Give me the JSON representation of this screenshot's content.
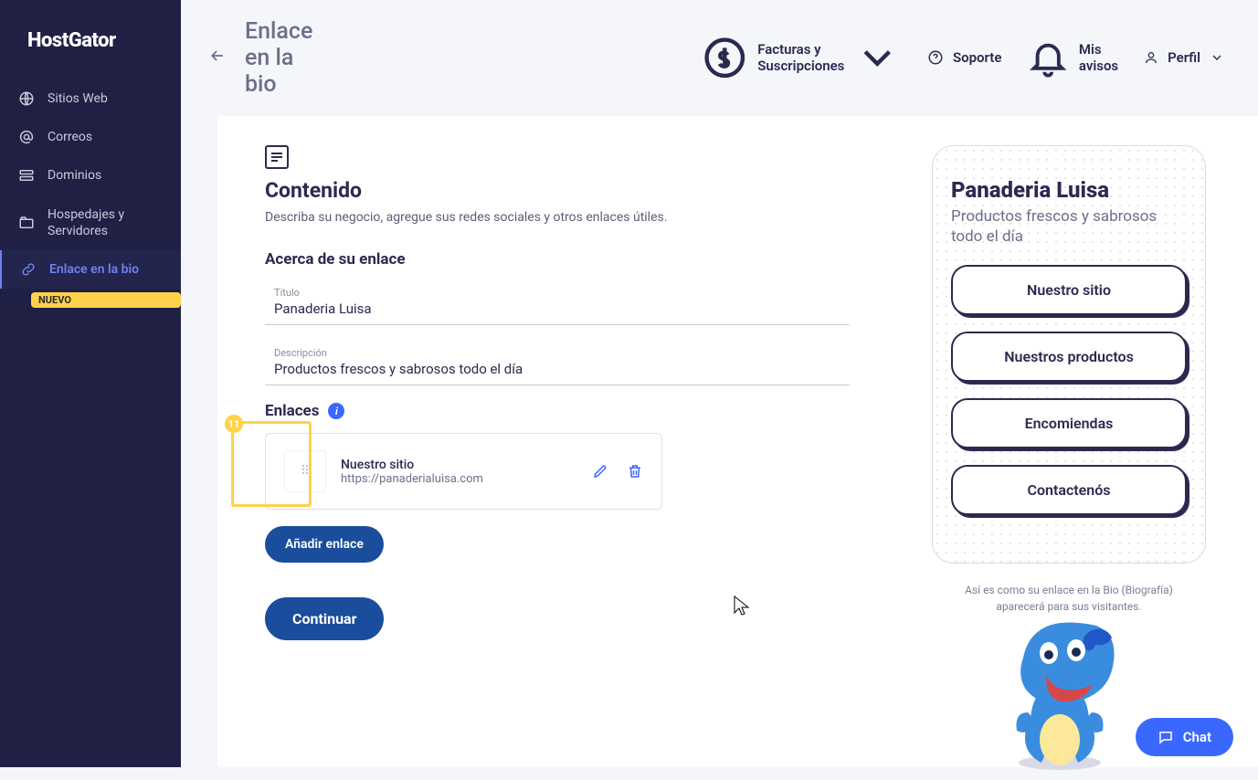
{
  "brand": "HostGator",
  "sidebar": {
    "items": [
      {
        "label": "Sitios Web"
      },
      {
        "label": "Correos"
      },
      {
        "label": "Dominios"
      },
      {
        "label": "Hospedajes y Servidores"
      },
      {
        "label": "Enlace en la bio",
        "badge": "NUEVO"
      }
    ]
  },
  "topbar": {
    "back_title": "Enlace en la bio",
    "billing": "Facturas y Suscripciones",
    "support": "Soporte",
    "notices": "Mis avisos",
    "profile": "Perfil"
  },
  "content": {
    "heading": "Contenido",
    "subheading": "Describa su negocio, agregue sus redes sociales y otros enlaces útiles.",
    "about_heading": "Acerca de su enlace",
    "title_label": "Título",
    "title_value": "Panaderia Luisa",
    "desc_label": "Descripción",
    "desc_value": "Productos frescos y sabrosos todo el día",
    "links_heading": "Enlaces",
    "link_item": {
      "title": "Nuestro sitio",
      "url": "https://panaderialuisa.com"
    },
    "callout_number": "11",
    "add_link": "Añadir enlace",
    "continue": "Continuar"
  },
  "preview": {
    "title": "Panaderia Luisa",
    "subtitle": "Productos frescos y sabrosos todo el día",
    "buttons": [
      "Nuestro sitio",
      "Nuestros productos",
      "Encomiendas",
      "Contactenós"
    ],
    "caption": "Así es como su enlace en la Bio (Biografía) aparecerá para sus visitantes."
  },
  "chat": "Chat"
}
